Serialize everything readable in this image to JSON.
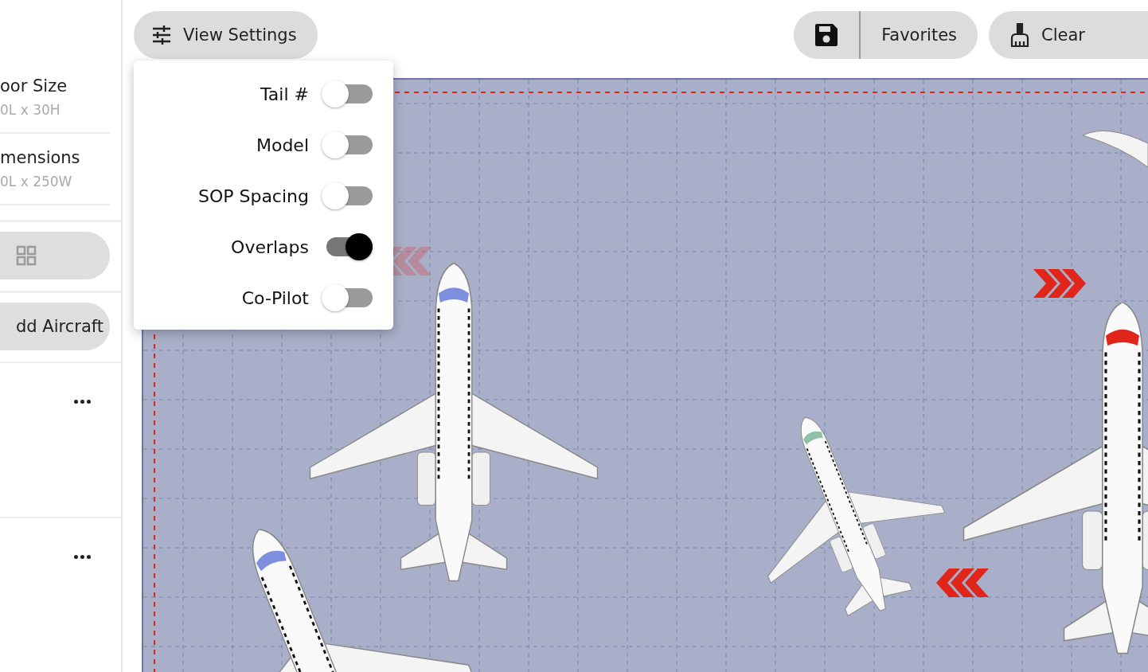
{
  "sidebar": {
    "fields": [
      {
        "label": "oor Size",
        "value": "0L x 30H"
      },
      {
        "label": "mensions",
        "value": "0L x 250W"
      }
    ],
    "add_button": "dd Aircraft"
  },
  "toolbar": {
    "view_settings": "View Settings",
    "favorites": "Favorites",
    "clear": "Clear"
  },
  "settings": {
    "toggles": [
      {
        "label": "Tail #",
        "on": false
      },
      {
        "label": "Model",
        "on": false
      },
      {
        "label": "SOP Spacing",
        "on": false
      },
      {
        "label": "Overlaps",
        "on": true
      },
      {
        "label": "Co-Pilot",
        "on": false
      }
    ]
  }
}
